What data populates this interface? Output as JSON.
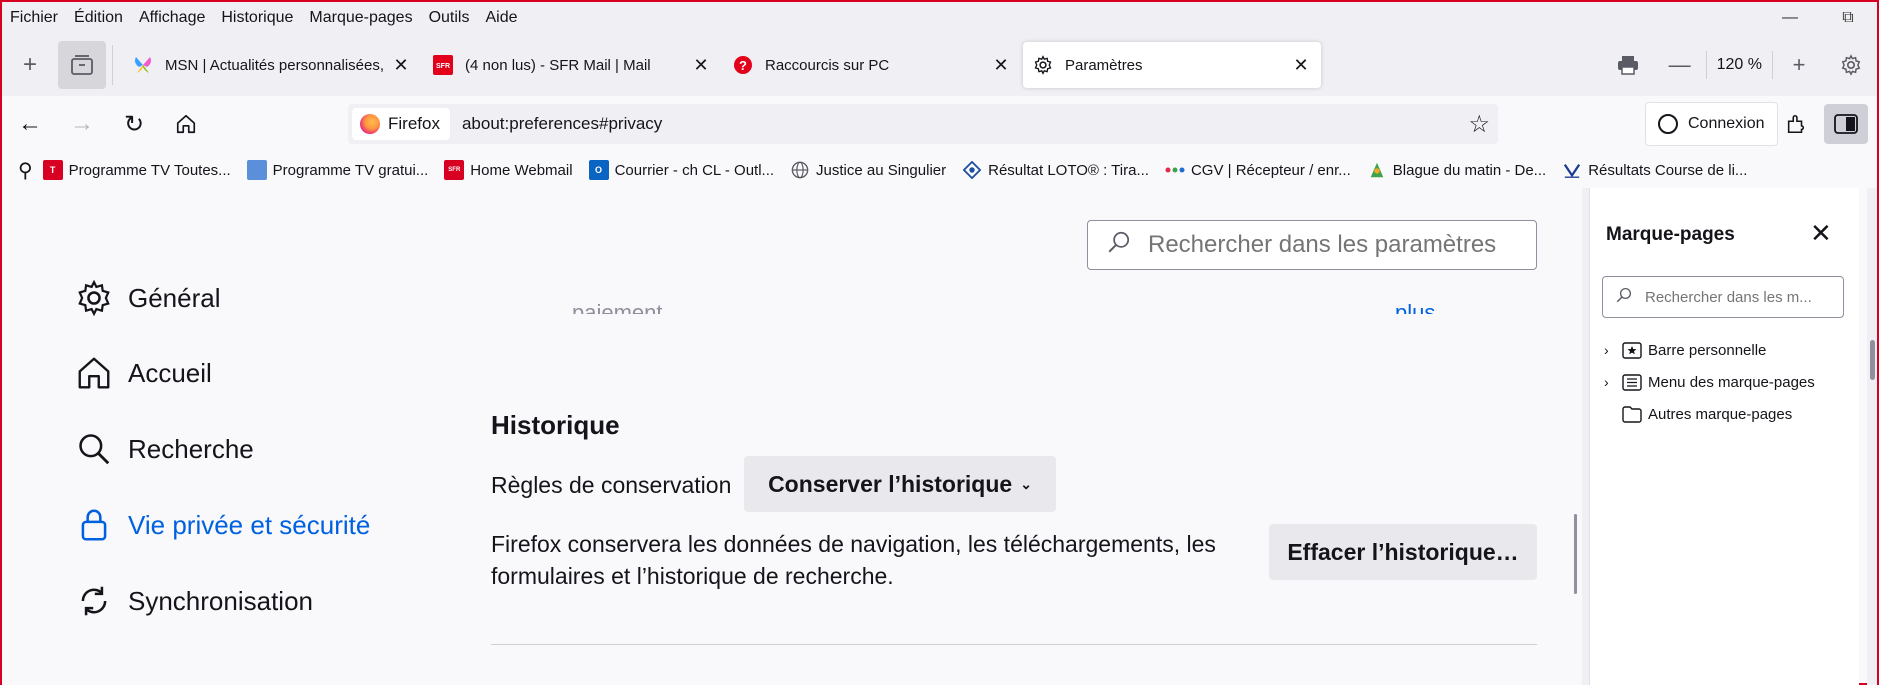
{
  "menubar": {
    "items": [
      "Fichier",
      "Édition",
      "Affichage",
      "Historique",
      "Marque-pages",
      "Outils",
      "Aide"
    ],
    "window_controls": [
      "minimize",
      "restore"
    ]
  },
  "tabs": [
    {
      "label": "MSN | Actualités personnalisées, ",
      "icon": "msn-butterfly-icon",
      "selected": false
    },
    {
      "label": "(4 non lus) - SFR Mail | Mail",
      "icon": "sfr-icon",
      "selected": false
    },
    {
      "label": "Raccourcis sur PC",
      "icon": "question-icon",
      "selected": false
    },
    {
      "label": "Paramètres",
      "icon": "gear-icon",
      "selected": true
    }
  ],
  "toolbar_right": {
    "zoom": "120 %"
  },
  "navbar": {
    "identity": "Firefox",
    "url": "about:preferences#privacy",
    "connexion": "Connexion"
  },
  "bookmarks": [
    {
      "label": "Programme TV Toutes...",
      "color": "#d70022",
      "badge": "T"
    },
    {
      "label": "Programme TV gratui...",
      "color": "#5b8fd9",
      "badge": ""
    },
    {
      "label": "Home Webmail",
      "color": "#d70022",
      "badge": "SFR"
    },
    {
      "label": "Courrier - ch CL - Outl...",
      "color": "#0a64c2",
      "badge": "O"
    },
    {
      "label": "Justice au Singulier",
      "color": "#5b5b66",
      "badge": ""
    },
    {
      "label": "Résultat LOTO® : Tira...",
      "color": "#1c4fa0",
      "badge": ""
    },
    {
      "label": "CGV | Récepteur / enr...",
      "color": "#e22850",
      "badge": ""
    },
    {
      "label": "Blague du matin - De...",
      "color": "#3fa34d",
      "badge": ""
    },
    {
      "label": "Résultats Course de li...",
      "color": "#1f3a93",
      "badge": ""
    }
  ],
  "preferences": {
    "search_placeholder": "Rechercher dans les paramètres",
    "categories": [
      {
        "label": "Général",
        "icon": "gear-icon",
        "selected": false
      },
      {
        "label": "Accueil",
        "icon": "home-icon",
        "selected": false
      },
      {
        "label": "Recherche",
        "icon": "search-icon",
        "selected": false
      },
      {
        "label": "Vie privée et sécurité",
        "icon": "lock-icon",
        "selected": true
      },
      {
        "label": "Synchronisation",
        "icon": "sync-icon",
        "selected": false
      }
    ],
    "partial_text": "paiement",
    "partial_link": "plus",
    "history": {
      "title": "Historique",
      "retention_label": "Règles de conservation",
      "retention_value": "Conserver l’historique",
      "description": "Firefox conservera les données de navigation, les téléchargements, les formulaires et l’historique de recherche.",
      "clear_button": "Effacer l’historique…"
    }
  },
  "sidebar": {
    "title": "Marque-pages",
    "search_placeholder": "Rechercher dans les m...",
    "items": [
      {
        "label": "Barre personnelle",
        "icon": "bookmark-toolbar-icon",
        "expandable": true
      },
      {
        "label": "Menu des marque-pages",
        "icon": "bookmark-menu-icon",
        "expandable": true
      },
      {
        "label": "Autres marque-pages",
        "icon": "folder-icon",
        "expandable": false
      }
    ]
  },
  "colors": {
    "accent": "#0061e0",
    "border": "#d70022"
  }
}
